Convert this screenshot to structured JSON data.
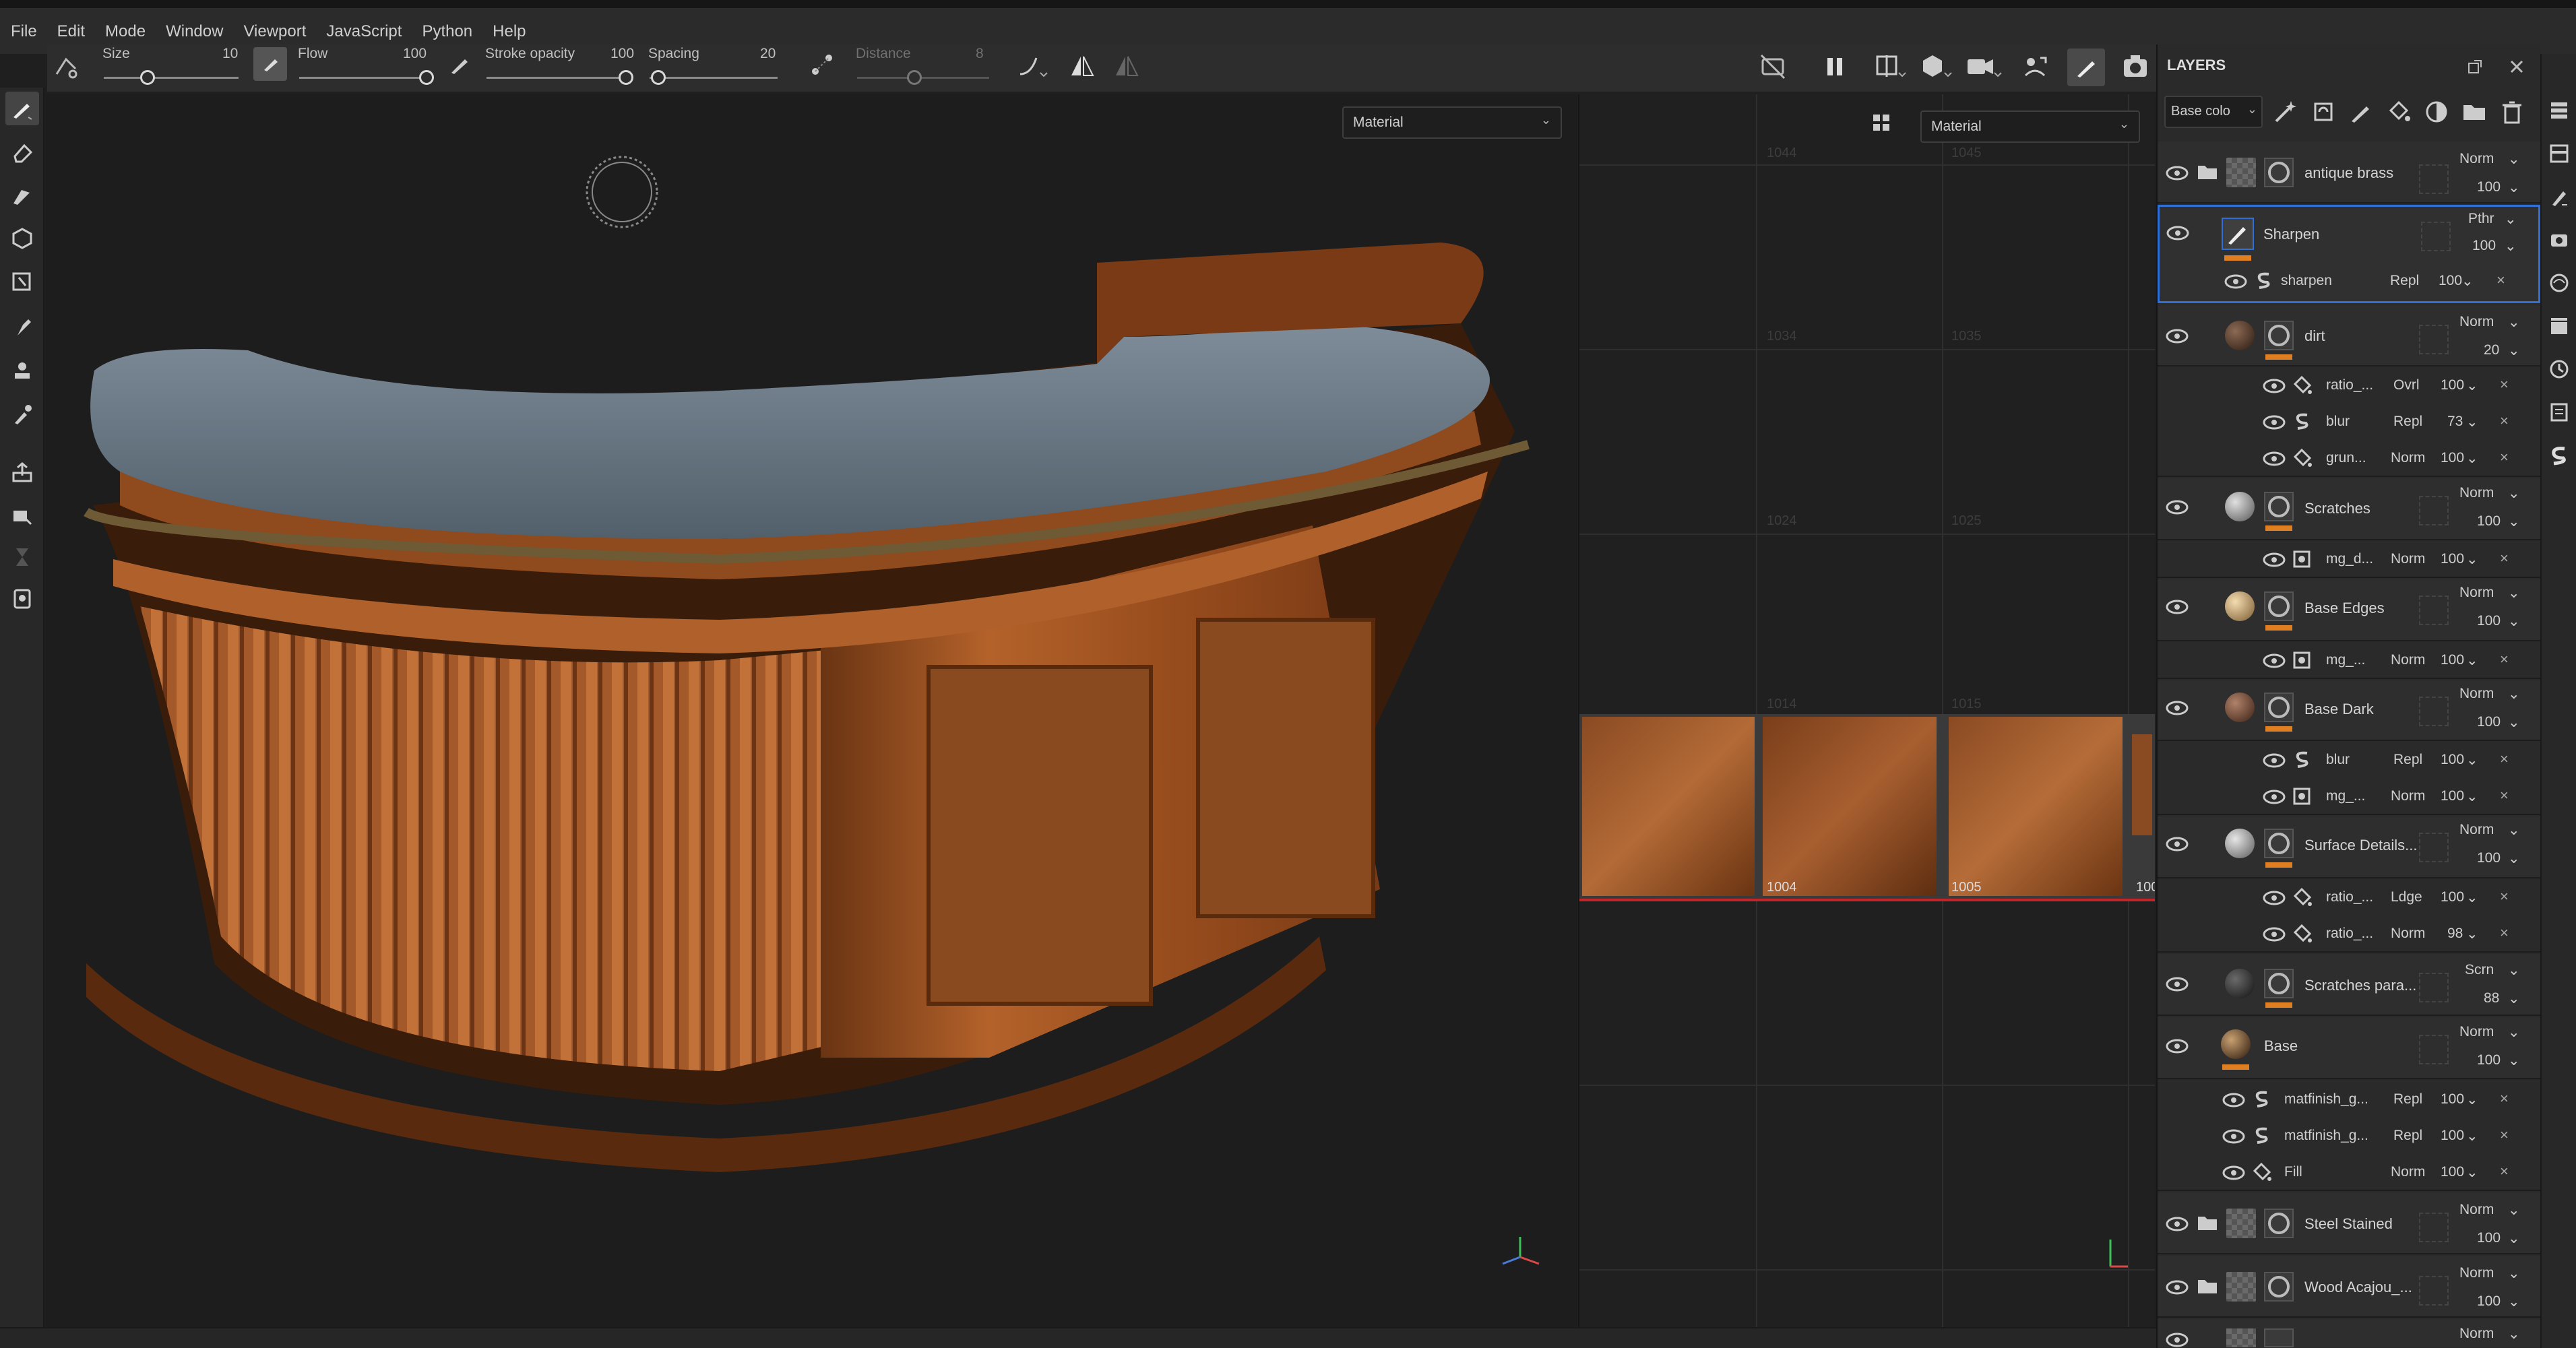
{
  "menu": [
    "File",
    "Edit",
    "Mode",
    "Window",
    "Viewport",
    "JavaScript",
    "Python",
    "Help"
  ],
  "toolbar": {
    "size_label": "Size",
    "size_value": "10",
    "flow_label": "Flow",
    "flow_value": "100",
    "stroke_opacity_label": "Stroke opacity",
    "stroke_opacity_value": "100",
    "spacing_label": "Spacing",
    "spacing_value": "20",
    "distance_label": "Distance",
    "distance_value": "8"
  },
  "viewport3d": {
    "material_select": "Material"
  },
  "viewport2d": {
    "material_select": "Material",
    "tile_labels": [
      "1044",
      "1045",
      "1034",
      "1035",
      "1024",
      "1025",
      "1014",
      "1015",
      "1004",
      "1005",
      "100"
    ]
  },
  "layers": {
    "title": "LAYERS",
    "channel_select": "Base colo",
    "rows": [
      {
        "name": "antique brass",
        "blend": "Norm",
        "opacity": "100"
      },
      {
        "name": "Sharpen",
        "blend": "Pthr",
        "opacity": "100"
      },
      {
        "name": "dirt",
        "blend": "Norm",
        "opacity": "20"
      },
      {
        "name": "Scratches",
        "blend": "Norm",
        "opacity": "100"
      },
      {
        "name": "Base Edges",
        "blend": "Norm",
        "opacity": "100"
      },
      {
        "name": "Base Dark",
        "blend": "Norm",
        "opacity": "100"
      },
      {
        "name": "Surface Details...",
        "blend": "Norm",
        "opacity": "100"
      },
      {
        "name": "Scratches para...",
        "blend": "Scrn",
        "opacity": "88"
      },
      {
        "name": "Base",
        "blend": "Norm",
        "opacity": "100"
      },
      {
        "name": "Steel Stained",
        "blend": "Norm",
        "opacity": "100"
      },
      {
        "name": "Wood Acajou_...",
        "blend": "Norm",
        "opacity": "100"
      },
      {
        "name": "",
        "blend": "Norm",
        "opacity": ""
      }
    ],
    "effects": [
      {
        "name": "sharpen",
        "blend": "Repl",
        "opacity": "100"
      },
      {
        "name": "ratio_...",
        "blend": "Ovrl",
        "opacity": "100"
      },
      {
        "name": "blur",
        "blend": "Repl",
        "opacity": "73"
      },
      {
        "name": "grun...",
        "blend": "Norm",
        "opacity": "100"
      },
      {
        "name": "mg_d...",
        "blend": "Norm",
        "opacity": "100"
      },
      {
        "name": "mg_...",
        "blend": "Norm",
        "opacity": "100"
      },
      {
        "name": "blur",
        "blend": "Repl",
        "opacity": "100"
      },
      {
        "name": "mg_...",
        "blend": "Norm",
        "opacity": "100"
      },
      {
        "name": "ratio_...",
        "blend": "Ldge",
        "opacity": "100"
      },
      {
        "name": "ratio_...",
        "blend": "Norm",
        "opacity": "98"
      },
      {
        "name": "matfinish_g...",
        "blend": "Repl",
        "opacity": "100"
      },
      {
        "name": "matfinish_g...",
        "blend": "Repl",
        "opacity": "100"
      },
      {
        "name": "Fill",
        "blend": "Norm",
        "opacity": "100"
      }
    ]
  },
  "colors": {
    "accent": "#e07f21",
    "selection": "#2f6fd6"
  }
}
